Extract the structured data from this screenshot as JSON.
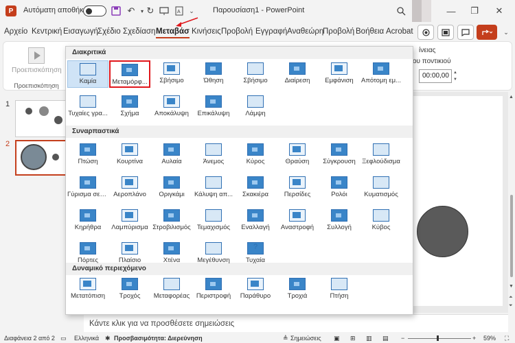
{
  "titlebar": {
    "autosave_label": "Αυτόματη αποθήκευση",
    "document_title": "Παρουσίαση1  -  PowerPoint"
  },
  "menu": {
    "tabs": [
      "Αρχείο",
      "Κεντρική",
      "Εισαγωγή",
      "Σχέδιο",
      "Σχεδίαση",
      "Μεταβάσ",
      "Κινήσεις",
      "Προβολή",
      "Εγγραφή",
      "Αναθεώρη",
      "Προβολή",
      "Βοήθεια",
      "Acrobat"
    ],
    "active_tab": "Μεταβάσ"
  },
  "ribbon": {
    "preview_label": "Προεπισκόπηση",
    "group_label": "Προεπισκόπηση",
    "right_text1": "ίνειας",
    "right_text2": "ου ποντικιού",
    "timing_value": "00:00,00"
  },
  "thumbnails": [
    {
      "number": "1",
      "active": false
    },
    {
      "number": "2",
      "active": true
    }
  ],
  "notes_placeholder": "Κάντε κλικ για να προσθέσετε σημειώσεις",
  "statusbar": {
    "slide_count": "Διαφάνεια 2 από 2",
    "language": "Ελληνικά",
    "accessibility": "Προσβασιμότητα: Διερεύνηση",
    "notes_button": "Σημειώσεις",
    "zoom": "59%"
  },
  "transitions": {
    "sections": [
      {
        "title": "Διακριτικά",
        "items": [
          "Καμία",
          "Μεταμόρφ...",
          "Σβήσιμο",
          "Ώθηση",
          "Σβήσιμο",
          "Διαίρεση",
          "Εμφάνιση",
          "Απότομη εμ...",
          "Τυχαίες γρα...",
          "Σχήμα",
          "Αποκάλυψη",
          "Επικάλυψη",
          "Λάμψη"
        ]
      },
      {
        "title": "Συναρπαστικά",
        "items": [
          "Πτώση",
          "Κουρτίνα",
          "Αυλαία",
          "Άνεμος",
          "Κύρος",
          "Θραύση",
          "Σύγκρουση",
          "Ξεφλούδισμα",
          "Γύρισμα σελ...",
          "Αεροπλάνο",
          "Οριγκάμι",
          "Κάλυψη απ...",
          "Σκακιέρα",
          "Περσίδες",
          "Ρολόι",
          "Κυματισμός",
          "Κηρήθρα",
          "Λαμπύρισμα",
          "Στροβιλισμός",
          "Τεμαχισμός",
          "Εναλλαγή",
          "Αναστροφή",
          "Συλλογή",
          "Κύβος",
          "Πόρτες",
          "Πλαίσιο",
          "Χτένα",
          "Μεγέθυνση",
          "Τυχαία"
        ]
      },
      {
        "title": "Δυναμικό περιεχόμενο",
        "items": [
          "Μετατόπιση",
          "Τροχός",
          "Μεταφορέας",
          "Περιστροφή",
          "Παράθυρο",
          "Τροχιά",
          "Πτήση"
        ]
      }
    ],
    "selected_item": "Καμία",
    "highlighted_item": "Μεταμόρφ...",
    "random_icon_glyph": "?"
  },
  "colors": {
    "accent": "#c43e1c",
    "highlight_box": "#e0161b",
    "icon_blue": "#3a85c8"
  }
}
